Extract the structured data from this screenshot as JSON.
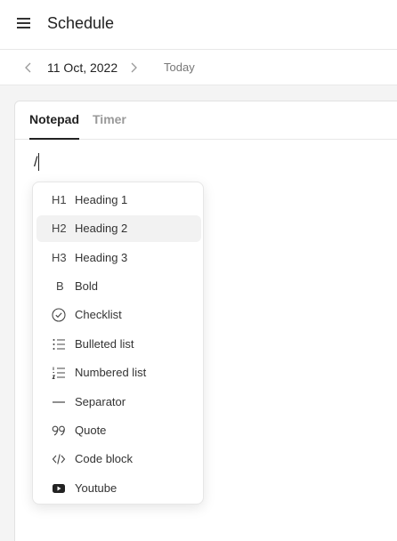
{
  "header": {
    "title": "Schedule",
    "menu_icon": "hamburger-icon"
  },
  "datebar": {
    "date": "11 Oct, 2022",
    "today_label": "Today"
  },
  "tabs": [
    {
      "label": "Notepad",
      "active": true
    },
    {
      "label": "Timer",
      "active": false
    }
  ],
  "editor": {
    "text": "/"
  },
  "menu": {
    "items": [
      {
        "icon": "H1",
        "label": "Heading 1"
      },
      {
        "icon": "H2",
        "label": "Heading 2",
        "highlighted": true
      },
      {
        "icon": "H3",
        "label": "Heading 3"
      },
      {
        "icon": "B",
        "label": "Bold"
      },
      {
        "icon": "check-circle-icon",
        "label": "Checklist"
      },
      {
        "icon": "bulleted-list-icon",
        "label": "Bulleted list"
      },
      {
        "icon": "numbered-list-icon",
        "label": "Numbered list"
      },
      {
        "icon": "separator-icon",
        "label": "Separator"
      },
      {
        "icon": "quote-icon",
        "label": "Quote"
      },
      {
        "icon": "code-icon",
        "label": "Code block"
      },
      {
        "icon": "youtube-icon",
        "label": "Youtube"
      }
    ]
  }
}
